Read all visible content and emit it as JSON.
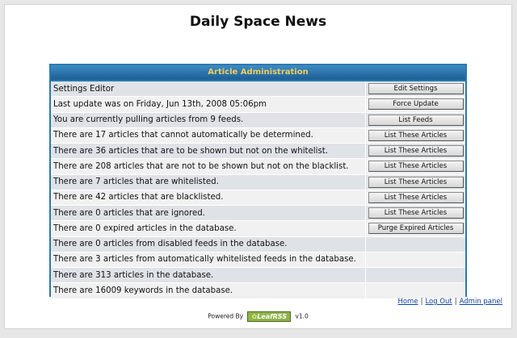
{
  "site": {
    "title": "Daily Space News"
  },
  "admin": {
    "header": "Article Administration",
    "rows": [
      {
        "text": "Settings Editor",
        "button": "Edit Settings"
      },
      {
        "text": "Last update was on Friday, Jun 13th, 2008 05:06pm",
        "button": "Force Update"
      },
      {
        "text": "You are currently pulling articles from 9 feeds.",
        "button": "List Feeds"
      },
      {
        "text": "There are 17 articles that cannot automatically be determined.",
        "button": "List These Articles"
      },
      {
        "text": "There are 36 articles that are to be shown but not on the whitelist.",
        "button": "List These Articles"
      },
      {
        "text": "There are 208 articles that are not to be shown but not on the blacklist.",
        "button": "List These Articles"
      },
      {
        "text": "There are 7 articles that are whitelisted.",
        "button": "List These Articles"
      },
      {
        "text": "There are 42 articles that are blacklisted.",
        "button": "List These Articles"
      },
      {
        "text": "There are 0 articles that are ignored.",
        "button": "List These Articles"
      },
      {
        "text": "There are 0 expired articles in the database.",
        "button": "Purge Expired Articles"
      },
      {
        "text": "There are 0 articles from disabled feeds in the database.",
        "button": ""
      },
      {
        "text": "There are 3 articles from automatically whitelisted feeds in the database.",
        "button": ""
      },
      {
        "text": "There are 313 articles in the database.",
        "button": ""
      },
      {
        "text": "There are 16009 keywords in the database.",
        "button": ""
      }
    ]
  },
  "footer": {
    "links": [
      "Home",
      "Log Out",
      "Admin panel"
    ],
    "powered_by": "Powered By",
    "logo_text": "LeafRSS",
    "version": "v1.0"
  }
}
